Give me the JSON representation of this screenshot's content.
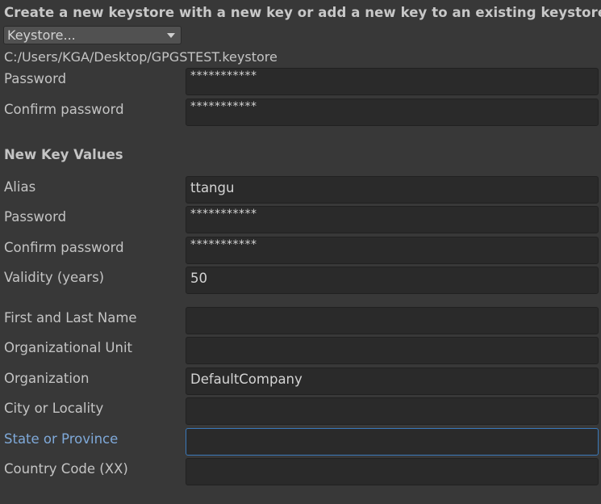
{
  "header": {
    "title": "Create a new keystore with a new key or add a new key to an existing keystore"
  },
  "keystore_dropdown": {
    "label": "Keystore..."
  },
  "keystore_path": "C:/Users/KGA/Desktop/GPGSTEST.keystore",
  "keystore": {
    "password_label": "Password",
    "password_value": "***********",
    "confirm_label": "Confirm password",
    "confirm_value": "***********"
  },
  "new_key": {
    "section_title": "New Key Values",
    "alias_label": "Alias",
    "alias_value": "ttangu",
    "password_label": "Password",
    "password_value": "***********",
    "confirm_label": "Confirm password",
    "confirm_value": "***********",
    "validity_label": "Validity (years)",
    "validity_value": "50"
  },
  "identity": {
    "name_label": "First and Last Name",
    "name_value": "",
    "unit_label": "Organizational Unit",
    "unit_value": "",
    "org_label": "Organization",
    "org_value": "DefaultCompany",
    "city_label": "City or Locality",
    "city_value": "",
    "state_label": "State or Province",
    "state_value": "",
    "country_label": "Country Code (XX)",
    "country_value": ""
  },
  "colors": {
    "background": "#383838",
    "field_bg": "#2a2a2a",
    "focus_border": "#3a79bb",
    "focus_label": "#7fa9d9"
  }
}
